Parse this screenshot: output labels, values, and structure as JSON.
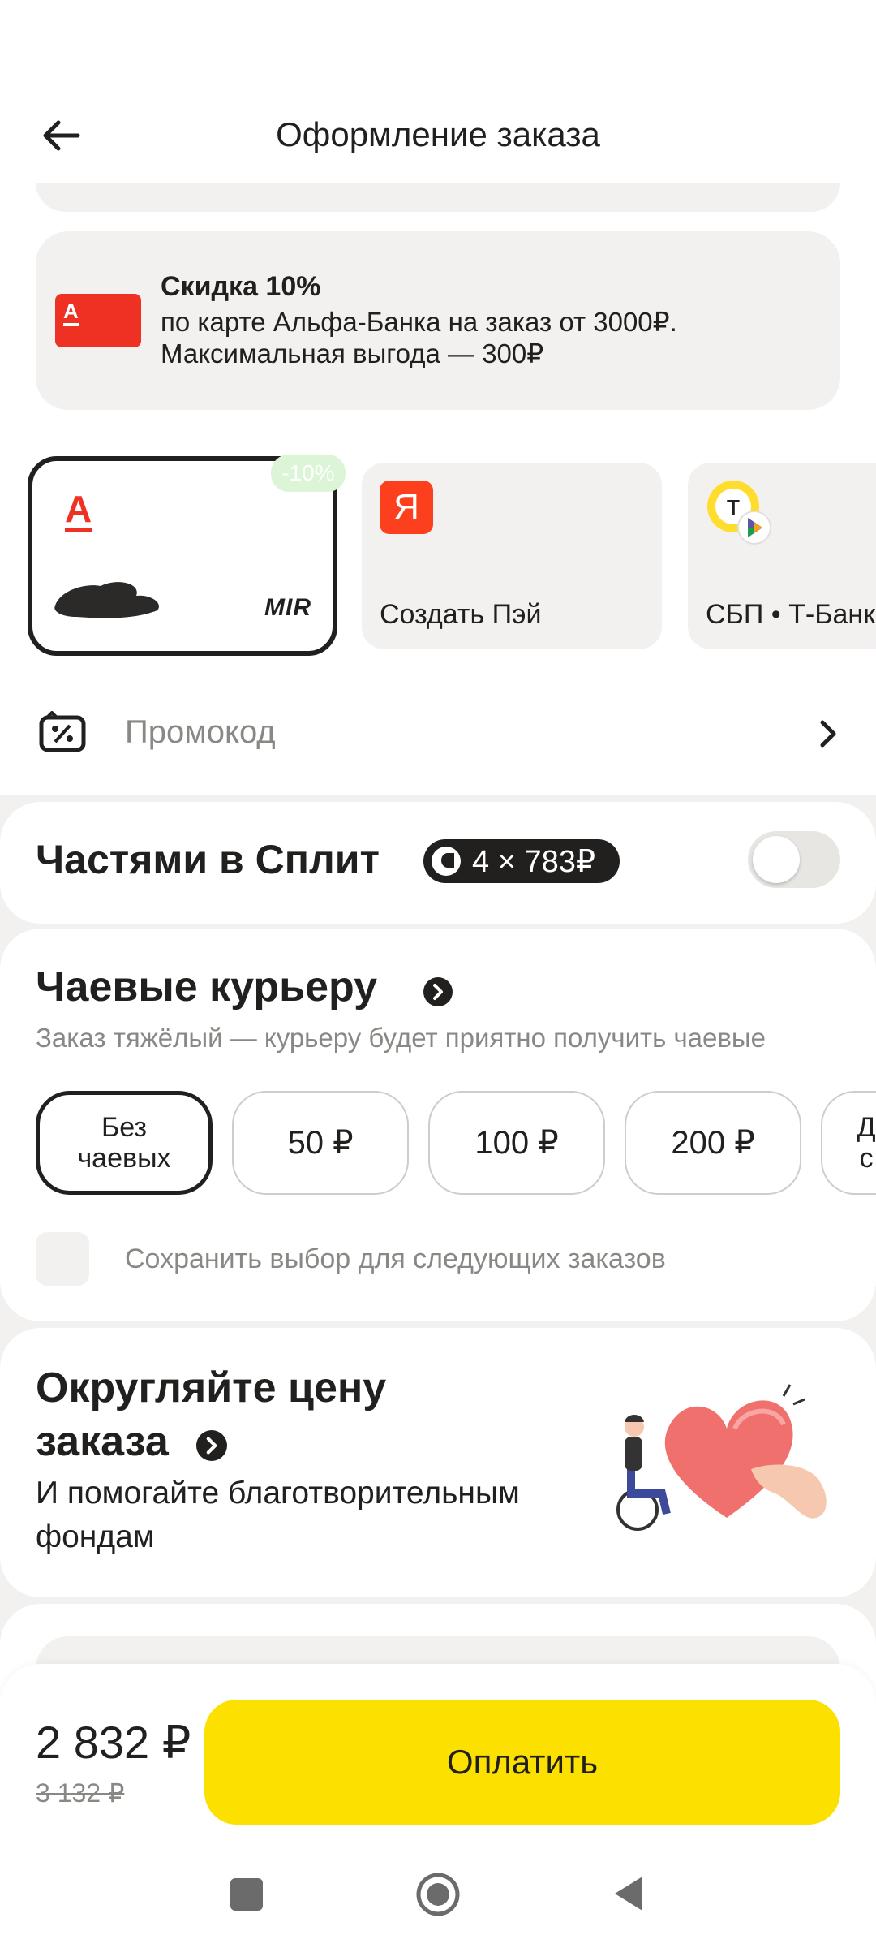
{
  "header": {
    "title": "Оформление заказа"
  },
  "promo_banner": {
    "title": "Скидка 10%",
    "line1": "по карте Альфа-Банка на заказ от 3000₽.",
    "line2": "Максимальная выгода — 300₽",
    "card_letter": "А"
  },
  "payment_methods": {
    "alfa": {
      "badge": "-10%",
      "logo": "А",
      "network": "MIR"
    },
    "yandex": {
      "logo": "Я",
      "label": "Создать Пэй"
    },
    "sbp": {
      "label": "СБП • Т-Банк",
      "logo": "T"
    }
  },
  "promocode": {
    "label": "Промокод"
  },
  "split": {
    "title": "Частями в Сплит",
    "badge": "4 × 783₽",
    "enabled": false
  },
  "tips": {
    "title": "Чаевые курьеру",
    "subtitle": "Заказ тяжёлый — курьеру будет приятно получить чаевые",
    "options": [
      "Без чаевых",
      "50 ₽",
      "100 ₽",
      "200 ₽",
      "Д с"
    ],
    "selected_index": 0,
    "save_label": "Сохранить выбор для следующих заказов"
  },
  "round_price": {
    "title_line1": "Округляйте цену",
    "title_line2": "заказа",
    "subtitle_line1": "И помогайте благотворительным",
    "subtitle_line2": "фондам"
  },
  "checkout": {
    "price": "2 832 ₽",
    "old_price": "3 132 ₽",
    "pay_label": "Оплатить"
  },
  "colors": {
    "accent_yellow": "#fce000",
    "alfa_red": "#ef3124",
    "yandex_red": "#fc3f1d",
    "background": "#f2f1ef"
  }
}
